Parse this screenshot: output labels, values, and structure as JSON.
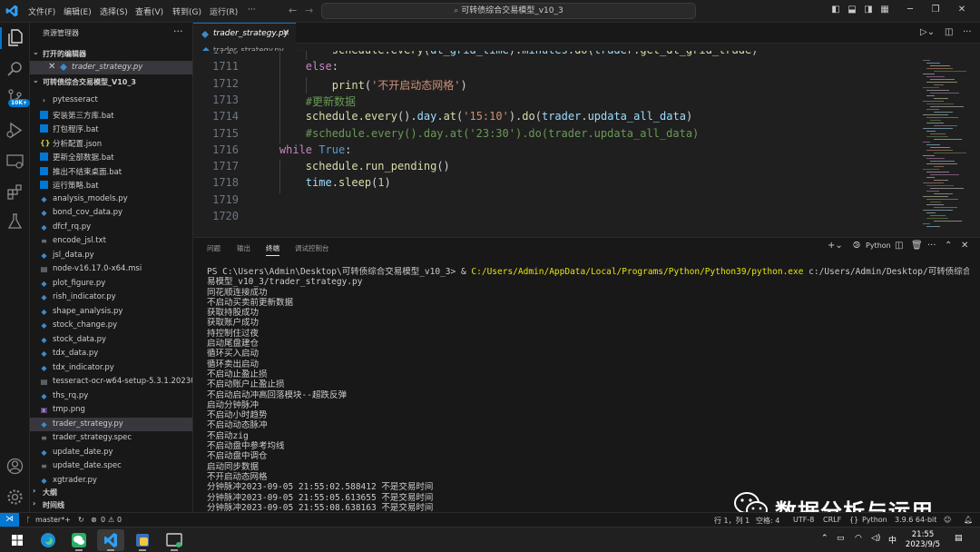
{
  "titlebar": {
    "menus": [
      "文件(F)",
      "编辑(E)",
      "选择(S)",
      "查看(V)",
      "转到(G)",
      "运行(R)"
    ],
    "more": "···",
    "command_center": "可转债综合交易模型_v10_3"
  },
  "activity": {
    "badge": "10K+"
  },
  "sidebar": {
    "title": "资源管理器",
    "more": "···",
    "open_editors_label": "打开的编辑器",
    "open_file": "trader_strategy.py",
    "workspace_label": "可转债综合交易模型_V10_3",
    "outline_label": "大纲",
    "timeline_label": "时间线",
    "files": [
      {
        "name": "pytesseract",
        "kind": "dir"
      },
      {
        "name": "安装第三方库.bat",
        "kind": "bat"
      },
      {
        "name": "打包程序.bat",
        "kind": "bat"
      },
      {
        "name": "分析配置.json",
        "kind": "json"
      },
      {
        "name": "更新全部数据.bat",
        "kind": "bat"
      },
      {
        "name": "推出不结束桌面.bat",
        "kind": "bat"
      },
      {
        "name": "运行策略.bat",
        "kind": "bat"
      },
      {
        "name": "analysis_models.py",
        "kind": "py"
      },
      {
        "name": "bond_cov_data.py",
        "kind": "py"
      },
      {
        "name": "dfcf_rq.py",
        "kind": "py"
      },
      {
        "name": "encode_jsl.txt",
        "kind": "txt"
      },
      {
        "name": "jsl_data.py",
        "kind": "py"
      },
      {
        "name": "node-v16.17.0-x64.msi",
        "kind": "exe"
      },
      {
        "name": "plot_figure.py",
        "kind": "py"
      },
      {
        "name": "rish_indicator.py",
        "kind": "py"
      },
      {
        "name": "shape_analysis.py",
        "kind": "py"
      },
      {
        "name": "stock_change.py",
        "kind": "py"
      },
      {
        "name": "stock_data.py",
        "kind": "py"
      },
      {
        "name": "tdx_data.py",
        "kind": "py"
      },
      {
        "name": "tdx_indicator.py",
        "kind": "py"
      },
      {
        "name": "tesseract-ocr-w64-setup-5.3.1.20230...",
        "kind": "exe"
      },
      {
        "name": "ths_rq.py",
        "kind": "py"
      },
      {
        "name": "tmp.png",
        "kind": "png"
      },
      {
        "name": "trader_strategy.py",
        "kind": "py",
        "selected": true
      },
      {
        "name": "trader_strategy.spec",
        "kind": "txt"
      },
      {
        "name": "update_date.py",
        "kind": "py"
      },
      {
        "name": "update_date.spec",
        "kind": "txt"
      },
      {
        "name": "xgtrader.py",
        "kind": "py"
      }
    ]
  },
  "editor": {
    "tab": "trader_strategy.py",
    "breadcrumb_file": "trader_strategy.py",
    "breadcrumb_more": "...",
    "lines": [
      {
        "n": "1710",
        "indent": 3,
        "tokens": [
          [
            "fn",
            "schedule"
          ],
          [
            "pn",
            "."
          ],
          [
            "fn",
            "every"
          ],
          [
            "pn",
            "("
          ],
          [
            "vr",
            "dt_grid_time"
          ],
          [
            "pn",
            ")."
          ],
          [
            "vr",
            "minutes"
          ],
          [
            "pn",
            "."
          ],
          [
            "fn",
            "do"
          ],
          [
            "pn",
            "("
          ],
          [
            "vr",
            "trader"
          ],
          [
            "pn",
            "."
          ],
          [
            "fn",
            "get_dt_grid_trade"
          ],
          [
            "pn",
            ")"
          ]
        ]
      },
      {
        "n": "1711",
        "indent": 2,
        "tokens": [
          [
            "kw",
            "else"
          ],
          [
            "pn",
            ":"
          ]
        ]
      },
      {
        "n": "1712",
        "indent": 3,
        "tokens": [
          [
            "fn",
            "print"
          ],
          [
            "pn",
            "("
          ],
          [
            "st",
            "'不开启动态网格'"
          ],
          [
            "pn",
            ")"
          ]
        ]
      },
      {
        "n": "1713",
        "indent": 2,
        "tokens": [
          [
            "cm",
            "#更新数据"
          ]
        ]
      },
      {
        "n": "1714",
        "indent": 2,
        "tokens": [
          [
            "fn",
            "schedule"
          ],
          [
            "pn",
            "."
          ],
          [
            "fn",
            "every"
          ],
          [
            "pn",
            "()."
          ],
          [
            "vr",
            "day"
          ],
          [
            "pn",
            "."
          ],
          [
            "fn",
            "at"
          ],
          [
            "pn",
            "("
          ],
          [
            "st",
            "'15:10'"
          ],
          [
            "pn",
            ")."
          ],
          [
            "fn",
            "do"
          ],
          [
            "pn",
            "("
          ],
          [
            "vr",
            "trader"
          ],
          [
            "pn",
            "."
          ],
          [
            "vr",
            "updata_all_data"
          ],
          [
            "pn",
            ")"
          ]
        ]
      },
      {
        "n": "1715",
        "indent": 2,
        "tokens": [
          [
            "cm",
            "#schedule.every().day.at('23:30').do(trader.updata_all_data)"
          ]
        ]
      },
      {
        "n": "1716",
        "indent": 1,
        "tokens": [
          [
            "kw",
            "while"
          ],
          [
            "pn",
            " "
          ],
          [
            "bl",
            "True"
          ],
          [
            "pn",
            ":"
          ]
        ]
      },
      {
        "n": "1717",
        "indent": 2,
        "tokens": [
          [
            "fn",
            "schedule"
          ],
          [
            "pn",
            "."
          ],
          [
            "fn",
            "run_pending"
          ],
          [
            "pn",
            "()"
          ]
        ]
      },
      {
        "n": "1718",
        "indent": 2,
        "tokens": [
          [
            "vr",
            "time"
          ],
          [
            "pn",
            "."
          ],
          [
            "fn",
            "sleep"
          ],
          [
            "pn",
            "("
          ],
          [
            "nu",
            "1"
          ],
          [
            "pn",
            ")"
          ]
        ]
      },
      {
        "n": "1719",
        "indent": 0,
        "tokens": []
      },
      {
        "n": "1720",
        "indent": 0,
        "tokens": []
      }
    ]
  },
  "panel": {
    "tabs": [
      "问题",
      "输出",
      "终端",
      "调试控制台"
    ],
    "active_tab": "终端",
    "shell_label": "Python",
    "terminal": [
      "PS C:\\Users\\Admin\\Desktop\\可转债综合交易模型_v10_3> & C:/Users/Admin/AppData/Local/Programs/Python/Python39/python.exe c:/Users/Admin/Desktop/可转债综合交",
      "易模型_v10_3/trader_strategy.py",
      "同花顺连接成功",
      "不启动买卖前更新数据",
      "获取持股成功",
      "获取账户成功",
      "持控制住过夜",
      "启动尾盘建仓",
      "循环买入启动",
      "循环卖出启动",
      "不启动止盈止损",
      "不启动账户止盈止损",
      "不启动启动冲高回落模块--超跌反弹",
      "启动分钟脉冲",
      "不启动小时趋势",
      "不启动动态脉冲",
      "不启动zig",
      "不启动盘中参考均线",
      "不启动盘中调仓",
      "启动同步数据",
      "不开启动态网格",
      "分钟脉冲2023-09-05 21:55:02.588412 不是交易时间",
      "分钟脉冲2023-09-05 21:55:05.613655 不是交易时间",
      "分钟脉冲2023-09-05 21:55:08.638163 不是交易时间"
    ]
  },
  "watermark": {
    "text": "数据分析与运用"
  },
  "statusbar": {
    "branch": "master*+",
    "errors": "0",
    "warnings": "0",
    "cursor": "行 1，列 1",
    "spaces": "空格: 4",
    "encoding": "UTF-8",
    "eol": "CRLF",
    "language": "Python",
    "interpreter": "3.9.6 64-bit"
  },
  "taskbar": {
    "time": "21:55",
    "date": "2023/9/5",
    "ime": "中"
  },
  "colors": {
    "accent": "#0078d4",
    "python_blue": "#3d8bcc",
    "json_yellow": "#cbcb41"
  }
}
